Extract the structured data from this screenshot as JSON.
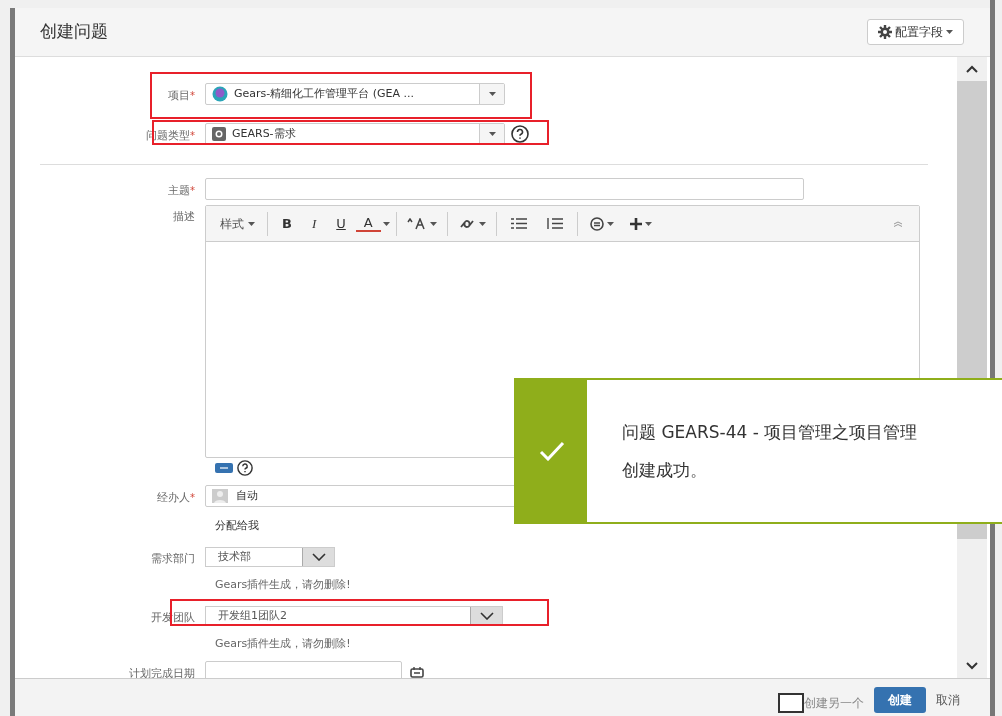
{
  "dialog": {
    "title": "创建问题",
    "configure_button": "配置字段"
  },
  "top_fields": [
    {
      "kind": "select",
      "label": "项目",
      "required_mark": "*",
      "highlighted": true,
      "value": "Gears-精细化工作管理平台 (GEA  ...",
      "help": false
    },
    {
      "kind": "select",
      "label": "问题类型",
      "required_mark": "*",
      "highlighted": true,
      "value": "GEARS-需求",
      "help": true
    }
  ],
  "fields": [
    {
      "kind": "text",
      "label": "主题",
      "required_mark": "*",
      "highlighted": false
    },
    {
      "kind": "editor",
      "label": "描述",
      "highlighted": false,
      "toolbar": [
        {
          "kind": "menu",
          "text": "样式"
        },
        {
          "kind": "sep"
        },
        {
          "kind": "bold",
          "text": "B"
        },
        {
          "kind": "italic",
          "text": "I"
        },
        {
          "kind": "underline",
          "text": "U"
        },
        {
          "kind": "color",
          "text": "A"
        },
        {
          "kind": "caret"
        },
        {
          "kind": "sep"
        },
        {
          "kind": "size"
        },
        {
          "kind": "sep"
        },
        {
          "kind": "link"
        },
        {
          "kind": "sep"
        },
        {
          "kind": "bullets"
        },
        {
          "kind": "numbers"
        },
        {
          "kind": "sep"
        },
        {
          "kind": "emoji"
        },
        {
          "kind": "plus"
        },
        {
          "kind": "collapse"
        }
      ]
    },
    {
      "kind": "user",
      "label": "经办人",
      "required_mark": "*",
      "highlighted": false,
      "value": "自动",
      "link": "分配给我"
    },
    {
      "kind": "dropdown",
      "label": "需求部门",
      "highlighted": false,
      "value": "技术部",
      "hint": "Gears插件生成，请勿删除!"
    },
    {
      "kind": "dropdown",
      "label": "开发团队",
      "highlighted": true,
      "value": "开发组1团队2",
      "hint": "Gears插件生成，请勿删除!"
    },
    {
      "kind": "date",
      "label": "计划完成日期",
      "highlighted": false
    }
  ],
  "toast": {
    "lines": [
      "问题 GEARS-44 - 项目管理之项目管理",
      "创建成功。"
    ]
  },
  "footer": {
    "create_another": {
      "label": "创建另一个",
      "checked": false
    },
    "create_button": "创建",
    "cancel_link": "取消"
  }
}
